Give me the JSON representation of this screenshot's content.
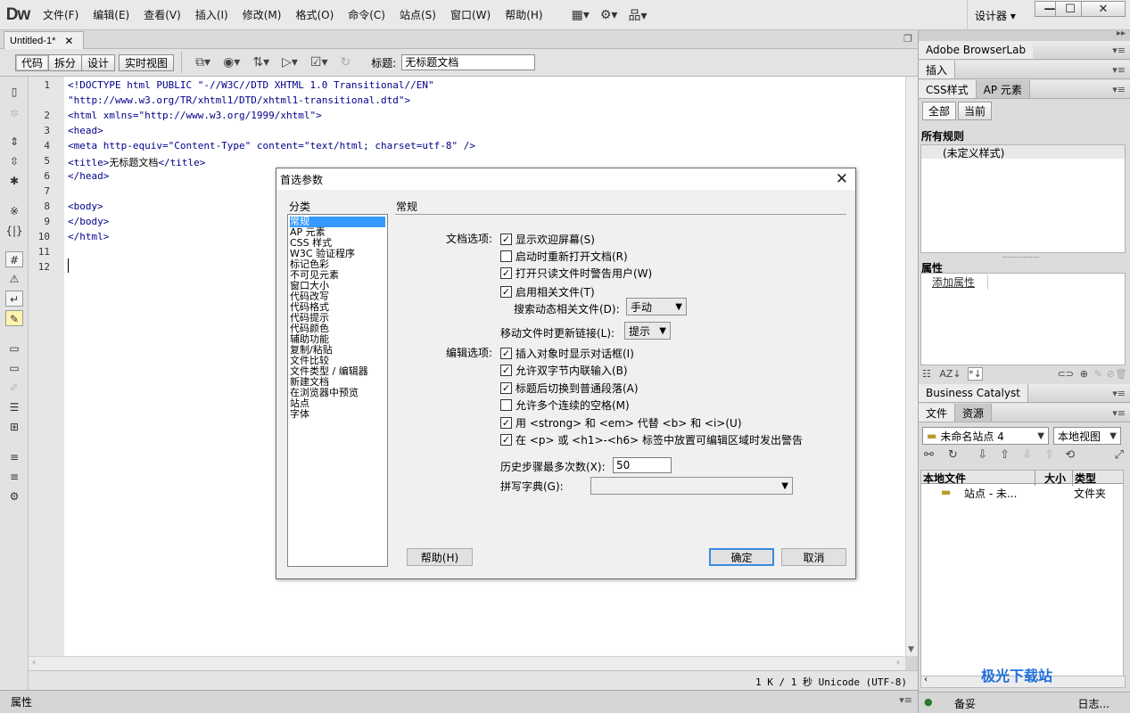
{
  "app": {
    "logo": "Dw"
  },
  "menu": [
    "文件(F)",
    "编辑(E)",
    "查看(V)",
    "插入(I)",
    "修改(M)",
    "格式(O)",
    "命令(C)",
    "站点(S)",
    "窗口(W)",
    "帮助(H)"
  ],
  "workspace": {
    "label": "设计器 ▾"
  },
  "window_controls": {
    "minimize": "—",
    "maximize": "☐",
    "close": "✕"
  },
  "doc_tab": {
    "name": "Untitled-1*",
    "close": "✕"
  },
  "doc_toolbar": {
    "views": [
      "代码",
      "拆分",
      "设计",
      "实时视图"
    ],
    "title_label": "标题:",
    "title_value": "无标题文档"
  },
  "code": {
    "line_numbers": [
      "1",
      "2",
      "3",
      "4",
      "5",
      "6",
      "7",
      "8",
      "9",
      "10",
      "11",
      "12"
    ],
    "lines": [
      "<!DOCTYPE html PUBLIC \"-//W3C//DTD XHTML 1.0 Transitional//EN\"",
      "\"http://www.w3.org/TR/xhtml1/DTD/xhtml1-transitional.dtd\">",
      "<html xmlns=\"http://www.w3.org/1999/xhtml\">",
      "<head>",
      "<meta http-equiv=\"Content-Type\" content=\"text/html; charset=utf-8\" />",
      "</head>",
      "",
      "<body>",
      "</body>",
      "</html>"
    ],
    "title_line": {
      "open": "<title>",
      "text": "无标题文档",
      "close": "</title>"
    }
  },
  "status": {
    "text": "1 K / 1 秒 Unicode (UTF-8)"
  },
  "properties_bar": {
    "label": "属性"
  },
  "right_panel": {
    "browserlab": "Adobe BrowserLab",
    "insert": "插入",
    "css_tabs": [
      "CSS样式",
      "AP 元素"
    ],
    "css_buttons": [
      "全部",
      "当前"
    ],
    "all_rules": "所有规则",
    "rule_item": "(未定义样式)",
    "properties": "属性",
    "add_property": "添加属性",
    "business_catalyst": "Business Catalyst",
    "files_tabs": [
      "文件",
      "资源"
    ],
    "site_select": "未命名站点 4",
    "view_select": "本地视图",
    "file_columns": [
      "本地文件",
      "大小",
      "类型"
    ],
    "file_row": {
      "name": "站点 - 未...",
      "type": "文件夹"
    },
    "bottom_bar": {
      "left": "备妥",
      "right": "日志..."
    }
  },
  "dialog": {
    "title": "首选参数",
    "close": "✕",
    "category_label": "分类",
    "categories": [
      "常规",
      "AP 元素",
      "CSS 样式",
      "W3C 验证程序",
      "标记色彩",
      "不可见元素",
      "窗口大小",
      "代码改写",
      "代码格式",
      "代码提示",
      "代码颜色",
      "辅助功能",
      "复制/粘贴",
      "文件比较",
      "文件类型 / 编辑器",
      "新建文档",
      "在浏览器中预览",
      "站点",
      "字体"
    ],
    "selected_category": "常规",
    "section_title": "常规",
    "doc_options_label": "文档选项:",
    "doc_options": [
      {
        "label": "显示欢迎屏幕(S)",
        "checked": true
      },
      {
        "label": "启动时重新打开文档(R)",
        "checked": false
      },
      {
        "label": "打开只读文件时警告用户(W)",
        "checked": true
      },
      {
        "label": "启用相关文件(T)",
        "checked": true
      }
    ],
    "search_related_label": "搜索动态相关文件(D):",
    "search_related_value": "手动",
    "update_links_label": "移动文件时更新链接(L):",
    "update_links_value": "提示",
    "edit_options_label": "编辑选项:",
    "edit_options": [
      {
        "label": "插入对象时显示对话框(I)",
        "checked": true
      },
      {
        "label": "允许双字节内联输入(B)",
        "checked": true
      },
      {
        "label": "标题后切换到普通段落(A)",
        "checked": true
      },
      {
        "label": "允许多个连续的空格(M)",
        "checked": false
      },
      {
        "label": "用 <strong> 和 <em> 代替 <b> 和 <i>(U)",
        "checked": true
      },
      {
        "label": "在 <p> 或 <h1>-<h6> 标签中放置可编辑区域时发出警告",
        "checked": true
      }
    ],
    "history_label": "历史步骤最多次数(X):",
    "history_value": "50",
    "spell_label": "拼写字典(G):",
    "spell_value": "",
    "help_button": "帮助(H)",
    "ok_button": "确定",
    "cancel_button": "取消"
  },
  "watermark": "极光下载站"
}
